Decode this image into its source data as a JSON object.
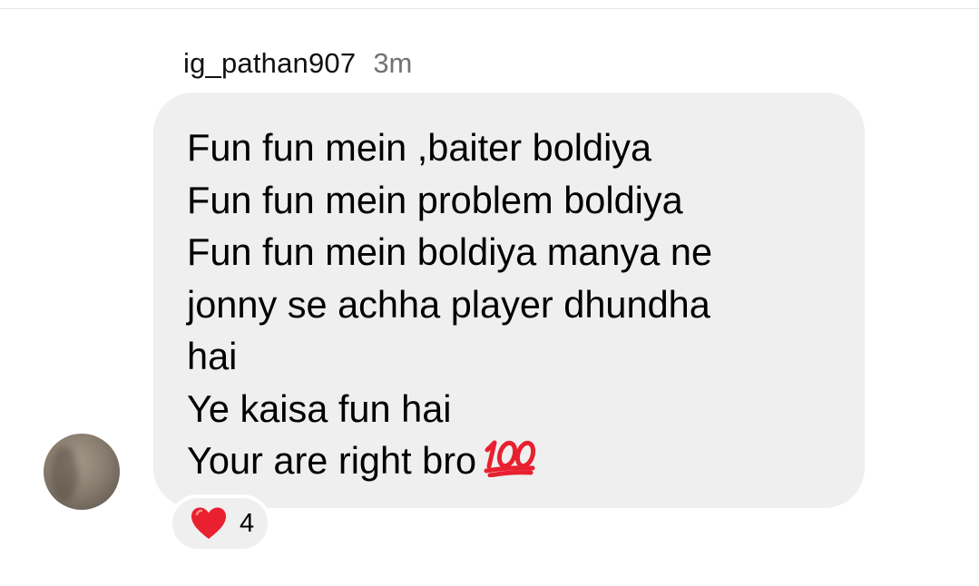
{
  "comment": {
    "username": "ig_pathan907",
    "timestamp": "3m",
    "lines": [
      "Fun fun mein ,baiter boldiya",
      "Fun fun mein problem boldiya",
      "Fun fun mein boldiya manya ne",
      "jonny se achha player dhundha",
      "hai",
      "Ye kaisa fun hai",
      "Your are right bro"
    ],
    "trailing_emoji_icon": "hundred-points-icon",
    "reaction": {
      "icon": "red-heart-icon",
      "count": "4"
    }
  },
  "colors": {
    "bubble_background": "#efefef",
    "timestamp_gray": "#737373",
    "heart_red": "#e8202f",
    "hundred_red": "#e8202f"
  }
}
